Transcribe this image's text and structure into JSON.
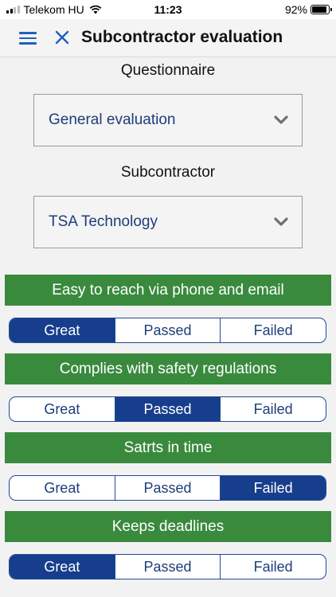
{
  "status_bar": {
    "carrier": "Telekom HU",
    "time": "11:23",
    "battery": "92%",
    "battery_level": 0.92
  },
  "header": {
    "title": "Subcontractor evaluation",
    "menu_icon": "hamburger-menu-icon",
    "close_icon": "close-icon"
  },
  "form": {
    "questionnaire_label": "Questionnaire",
    "questionnaire_value": "General evaluation",
    "subcontractor_label": "Subcontractor",
    "subcontractor_value": "TSA Technology"
  },
  "criteria": [
    {
      "title": "Easy to reach via phone and email",
      "options": [
        "Great",
        "Passed",
        "Failed"
      ],
      "selected": "Great"
    },
    {
      "title": "Complies with safety regulations",
      "options": [
        "Great",
        "Passed",
        "Failed"
      ],
      "selected": "Passed"
    },
    {
      "title": "Satrts in time",
      "options": [
        "Great",
        "Passed",
        "Failed"
      ],
      "selected": "Failed"
    },
    {
      "title": "Keeps deadlines",
      "options": [
        "Great",
        "Passed",
        "Failed"
      ],
      "selected": "Great"
    }
  ],
  "colors": {
    "accent": "#1f5fbf",
    "selected_segment": "#173e8c",
    "criterion_header": "#3a8a3e",
    "select_text": "#1e3d7a"
  }
}
